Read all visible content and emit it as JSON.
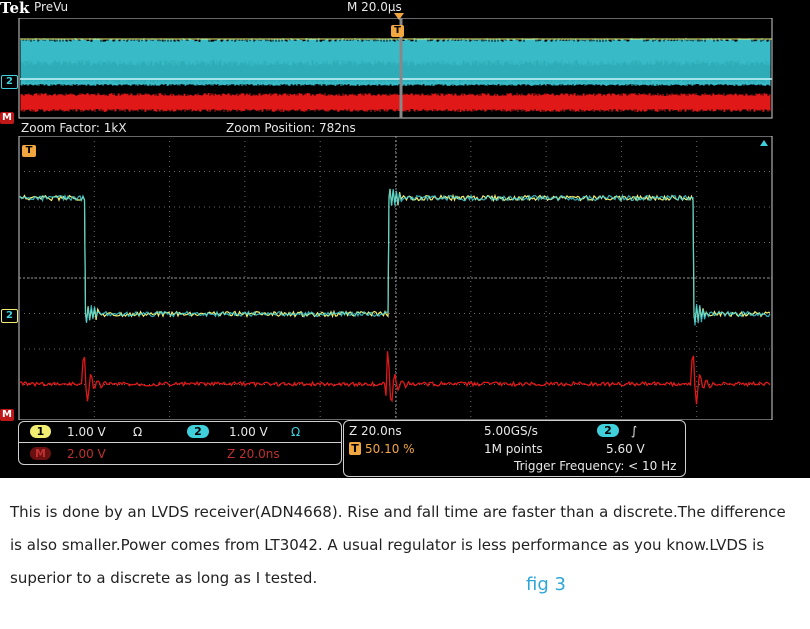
{
  "header": {
    "brand": "Tek",
    "mode": "PreVu",
    "timebase": "M 20.0µs",
    "trigger_marker": "T"
  },
  "overview": {
    "channel2_marker": "2",
    "math_marker": "M"
  },
  "zoom": {
    "factor": "Zoom Factor: 1kX",
    "position": "Zoom Position: 782ns"
  },
  "main": {
    "trigger_marker": "T",
    "channel2_marker": "2",
    "math_marker": "M"
  },
  "channels": {
    "ch1": {
      "badge": "1",
      "scale": "1.00 V",
      "coupling": "Ω"
    },
    "ch2": {
      "badge": "2",
      "scale": "1.00 V",
      "coupling": "Ω"
    },
    "math": {
      "badge": "M",
      "scale": "2.00 V",
      "zoom": "Z 20.0ns"
    }
  },
  "acquisition": {
    "zoom_scale": "Z 20.0ns",
    "trigger_badge": "T",
    "trigger_position": "50.10 %",
    "sample_rate": "5.00GS/s",
    "record_length": "1M points",
    "trigger_source": "2",
    "trigger_slope": "∫",
    "trigger_level": "5.60 V",
    "trigger_frequency": "Trigger Frequency: < 10 Hz"
  },
  "caption": {
    "text": "This is done by an LVDS receiver(ADN4668). Rise and fall time are faster than a discrete.The difference is also smaller.Power comes from LT3042. A usual regulator is less performance as you know.LVDS is superior to a discrete as long as I tested.",
    "figure_label": "fig 3"
  },
  "colors": {
    "ch1": "#f2ee72",
    "ch2": "#3fd0dc",
    "math": "#e01818",
    "grid": "#6a6a6a",
    "frame": "#cfcfcf"
  }
}
